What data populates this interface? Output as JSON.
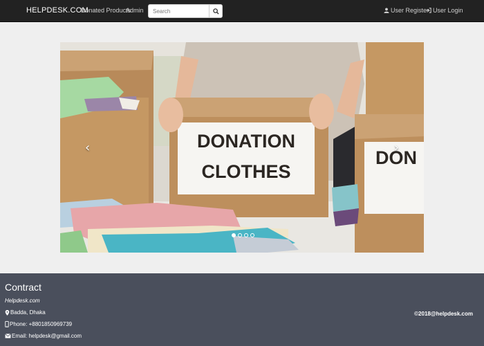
{
  "navbar": {
    "brand": "HELPDESK.COM",
    "links": [
      "Donated Products",
      "Admin"
    ],
    "search": {
      "placeholder": "Search",
      "value": ""
    },
    "search_icon": "search-icon",
    "register": {
      "label": "User Register",
      "icon": "user-icon"
    },
    "login": {
      "label": "User Login",
      "icon": "login-icon"
    }
  },
  "carousel": {
    "slide_text_line1": "DONATION",
    "slide_text_line2": "CLOTHES",
    "side_box_text": "DON",
    "prev_icon": "chevron-left-icon",
    "next_icon": "chevron-right-icon",
    "slides_count": 4,
    "active_slide": 1
  },
  "footer": {
    "title": "Contract",
    "site": "Helpdesk.com",
    "address": "Badda, Dhaka",
    "phone": "Phone: +8801850969739",
    "email": "Email: helpdesk@gmail.com",
    "copyright": "©2018@helpdesk.com",
    "icons": [
      "map-marker-icon",
      "phone-icon",
      "envelope-icon"
    ]
  },
  "colors": {
    "navbar_bg": "#222222",
    "page_bg": "#efefef",
    "footer_bg": "#4a4f5c"
  }
}
